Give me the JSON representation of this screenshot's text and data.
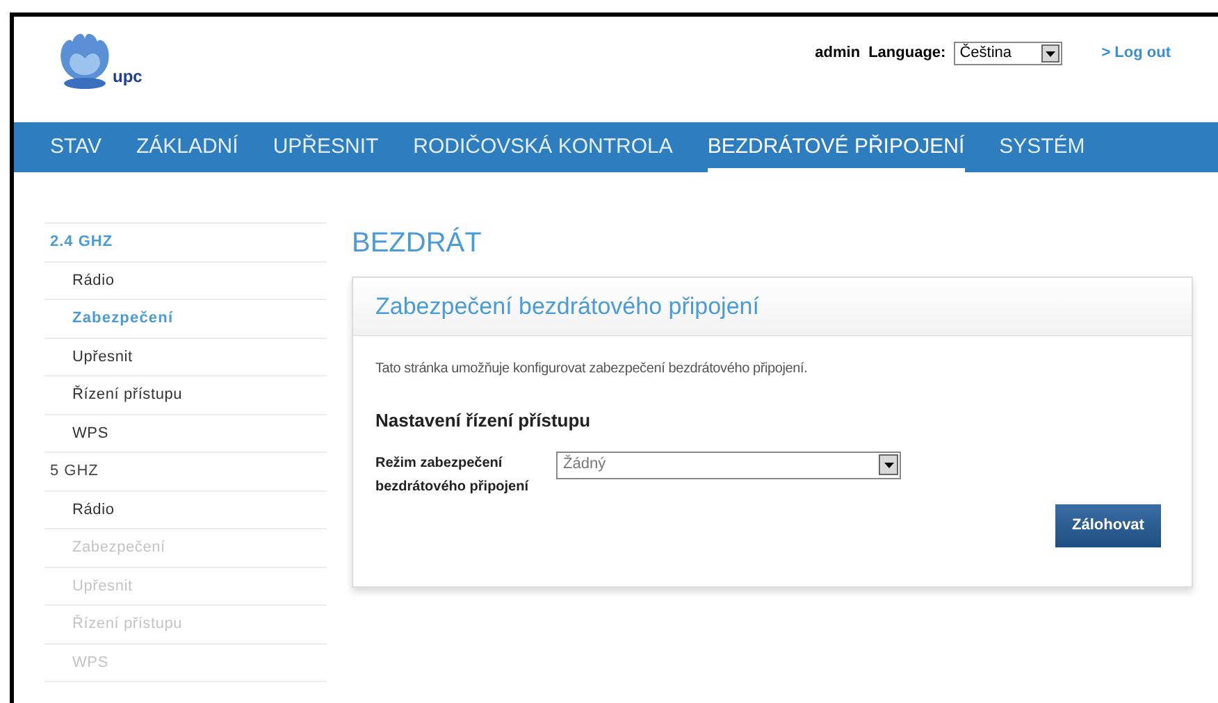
{
  "header": {
    "user": "admin",
    "language_label": "Language:",
    "language": {
      "value": "Čeština"
    },
    "logout": "> Log out",
    "logo_text": "upc"
  },
  "nav": [
    {
      "label": "STAV",
      "selected": false
    },
    {
      "label": "ZÁKLADNÍ",
      "selected": false
    },
    {
      "label": "UPŘESNIT",
      "selected": false
    },
    {
      "label": "RODIČOVSKÁ KONTROLA",
      "selected": false
    },
    {
      "label": "BEZDRÁTOVÉ PŘIPOJENÍ",
      "selected": true
    },
    {
      "label": "SYSTÉM",
      "selected": false
    }
  ],
  "sidebar": [
    {
      "label": "2.4 GHZ",
      "selected": true,
      "children": [
        {
          "label": "Rádio",
          "selected": false,
          "disabled": false
        },
        {
          "label": "Zabezpečení",
          "selected": true,
          "disabled": false
        },
        {
          "label": "Upřesnit",
          "selected": false,
          "disabled": false
        },
        {
          "label": "Řízení přístupu",
          "selected": false,
          "disabled": false
        },
        {
          "label": "WPS",
          "selected": false,
          "disabled": false
        }
      ]
    },
    {
      "label": "5 GHZ",
      "selected": false,
      "children": [
        {
          "label": "Rádio",
          "selected": false,
          "disabled": false
        },
        {
          "label": "Zabezpečení",
          "selected": false,
          "disabled": true
        },
        {
          "label": "Upřesnit",
          "selected": false,
          "disabled": true
        },
        {
          "label": "Řízení přístupu",
          "selected": false,
          "disabled": true
        },
        {
          "label": "WPS",
          "selected": false,
          "disabled": true
        }
      ]
    }
  ],
  "page_title": "BEZDRÁT",
  "card": {
    "title": "Zabezpečení bezdrátového připojení",
    "description": "Tato stránka umožňuje konfigurovat zabezpečení bezdrátového připojení.",
    "section": "Nastavení řízení přístupu",
    "fields": [
      {
        "label": "Režim zabezpečení bezdrátového připojení",
        "value": "Žádný"
      }
    ],
    "button": "Zálohovat"
  }
}
